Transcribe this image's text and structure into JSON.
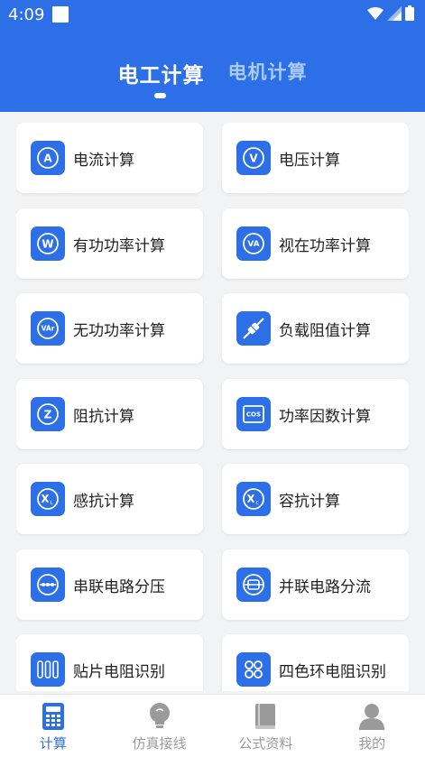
{
  "status": {
    "time": "4:09"
  },
  "tabs": [
    {
      "label": "电工计算",
      "active": true
    },
    {
      "label": "电机计算",
      "active": false
    }
  ],
  "cards": [
    {
      "label": "电流计算",
      "icon": "ammeter-a-icon",
      "glyph": "A"
    },
    {
      "label": "电压计算",
      "icon": "voltmeter-v-icon",
      "glyph": "V"
    },
    {
      "label": "有功功率计算",
      "icon": "watt-w-icon",
      "glyph": "W"
    },
    {
      "label": "视在功率计算",
      "icon": "va-icon",
      "glyph": "VA"
    },
    {
      "label": "无功功率计算",
      "icon": "var-icon",
      "glyph": "VAr"
    },
    {
      "label": "负载阻值计算",
      "icon": "resistor-icon",
      "glyph": ""
    },
    {
      "label": "阻抗计算",
      "icon": "impedance-z-icon",
      "glyph": "Z"
    },
    {
      "label": "功率因数计算",
      "icon": "cos-icon",
      "glyph": "COS"
    },
    {
      "label": "感抗计算",
      "icon": "xl-icon",
      "glyph": "XL"
    },
    {
      "label": "容抗计算",
      "icon": "xc-icon",
      "glyph": "Xc"
    },
    {
      "label": "串联电路分压",
      "icon": "series-circuit-icon",
      "glyph": ""
    },
    {
      "label": "并联电路分流",
      "icon": "parallel-circuit-icon",
      "glyph": ""
    },
    {
      "label": "贴片电阻识别",
      "icon": "smd-resistor-icon",
      "glyph": ""
    },
    {
      "label": "四色环电阻识别",
      "icon": "color-ring-icon",
      "glyph": ""
    }
  ],
  "bottom_nav": [
    {
      "label": "计算",
      "icon": "calculator-icon",
      "active": true
    },
    {
      "label": "仿真接线",
      "icon": "lightbulb-icon",
      "active": false
    },
    {
      "label": "公式资料",
      "icon": "book-icon",
      "active": false
    },
    {
      "label": "我的",
      "icon": "user-icon",
      "active": false
    }
  ],
  "colors": {
    "primary": "#2d6fe6",
    "inactive_tab": "#a9cafa",
    "nav_inactive": "#9a9a9a"
  }
}
